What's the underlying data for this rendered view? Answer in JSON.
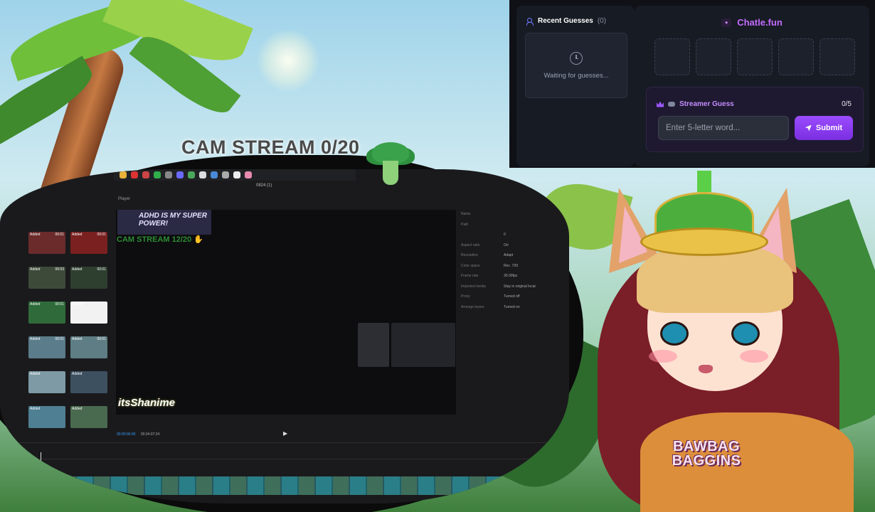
{
  "stream": {
    "cam_title": "CAM STREAM 0/20"
  },
  "editor": {
    "window_title": "0824 (1)",
    "player_label": "Player",
    "overlay_banner": "ADHD IS MY SUPER POWER!",
    "overlay_cam": "CAM STREAM 12/20",
    "overlay_logo": "itsShanime",
    "timecode_current": "00:00:00:00",
    "timecode_total": "00:34:07:24",
    "media_thumbs": [
      {
        "status": "Added",
        "duration": "00:01",
        "color": "#6b2b2b"
      },
      {
        "status": "Added",
        "duration": "00:01",
        "color": "#7a2020"
      },
      {
        "status": "Added",
        "duration": "00:03",
        "color": "#3d4a3a"
      },
      {
        "status": "Added",
        "duration": "00:01",
        "color": "#2e3f30"
      },
      {
        "status": "Added",
        "duration": "00:01",
        "color": "#2f6b3a"
      },
      {
        "status": "Added",
        "duration": "",
        "color": "#f2f2f2"
      },
      {
        "status": "Added",
        "duration": "00:01",
        "color": "#5b7c8a"
      },
      {
        "status": "Added",
        "duration": "00:01",
        "color": "#5e7d84"
      },
      {
        "status": "Added",
        "duration": "",
        "color": "#7d9aa5"
      },
      {
        "status": "Added",
        "duration": "",
        "color": "#3d5060"
      },
      {
        "status": "Added",
        "duration": "",
        "color": "#4f7f92"
      },
      {
        "status": "Added",
        "duration": "",
        "color": "#4a6a50"
      }
    ],
    "properties": [
      {
        "key": "Name",
        "value": ""
      },
      {
        "key": "Path",
        "value": ""
      },
      {
        "key": "",
        "value": "0"
      },
      {
        "key": "Aspect ratio",
        "value": "Ori"
      },
      {
        "key": "Resolution",
        "value": "Adapt"
      },
      {
        "key": "Color space",
        "value": "Rec. 709"
      },
      {
        "key": "Frame rate",
        "value": "30.00fps"
      },
      {
        "key": "Imported media",
        "value": "Stay in original locat"
      },
      {
        "key": "",
        "value": ""
      },
      {
        "key": "Proxy",
        "value": "Turned off"
      },
      {
        "key": "Arrange layers",
        "value": "Turned on"
      }
    ]
  },
  "chatle": {
    "recent": {
      "title": "Recent Guesses",
      "count": "(0)",
      "waiting_text": "Waiting for guesses..."
    },
    "brand_name": "Chatle.fun",
    "tiles": [
      "",
      "",
      "",
      "",
      ""
    ],
    "streamer_guess": {
      "label": "Streamer Guess",
      "count": "0/5",
      "placeholder": "Enter 5-letter word...",
      "submit_label": "Submit"
    },
    "accent": "#c46cff"
  },
  "vtuber": {
    "shirt_text": "BAWBAG BAGGINS"
  }
}
